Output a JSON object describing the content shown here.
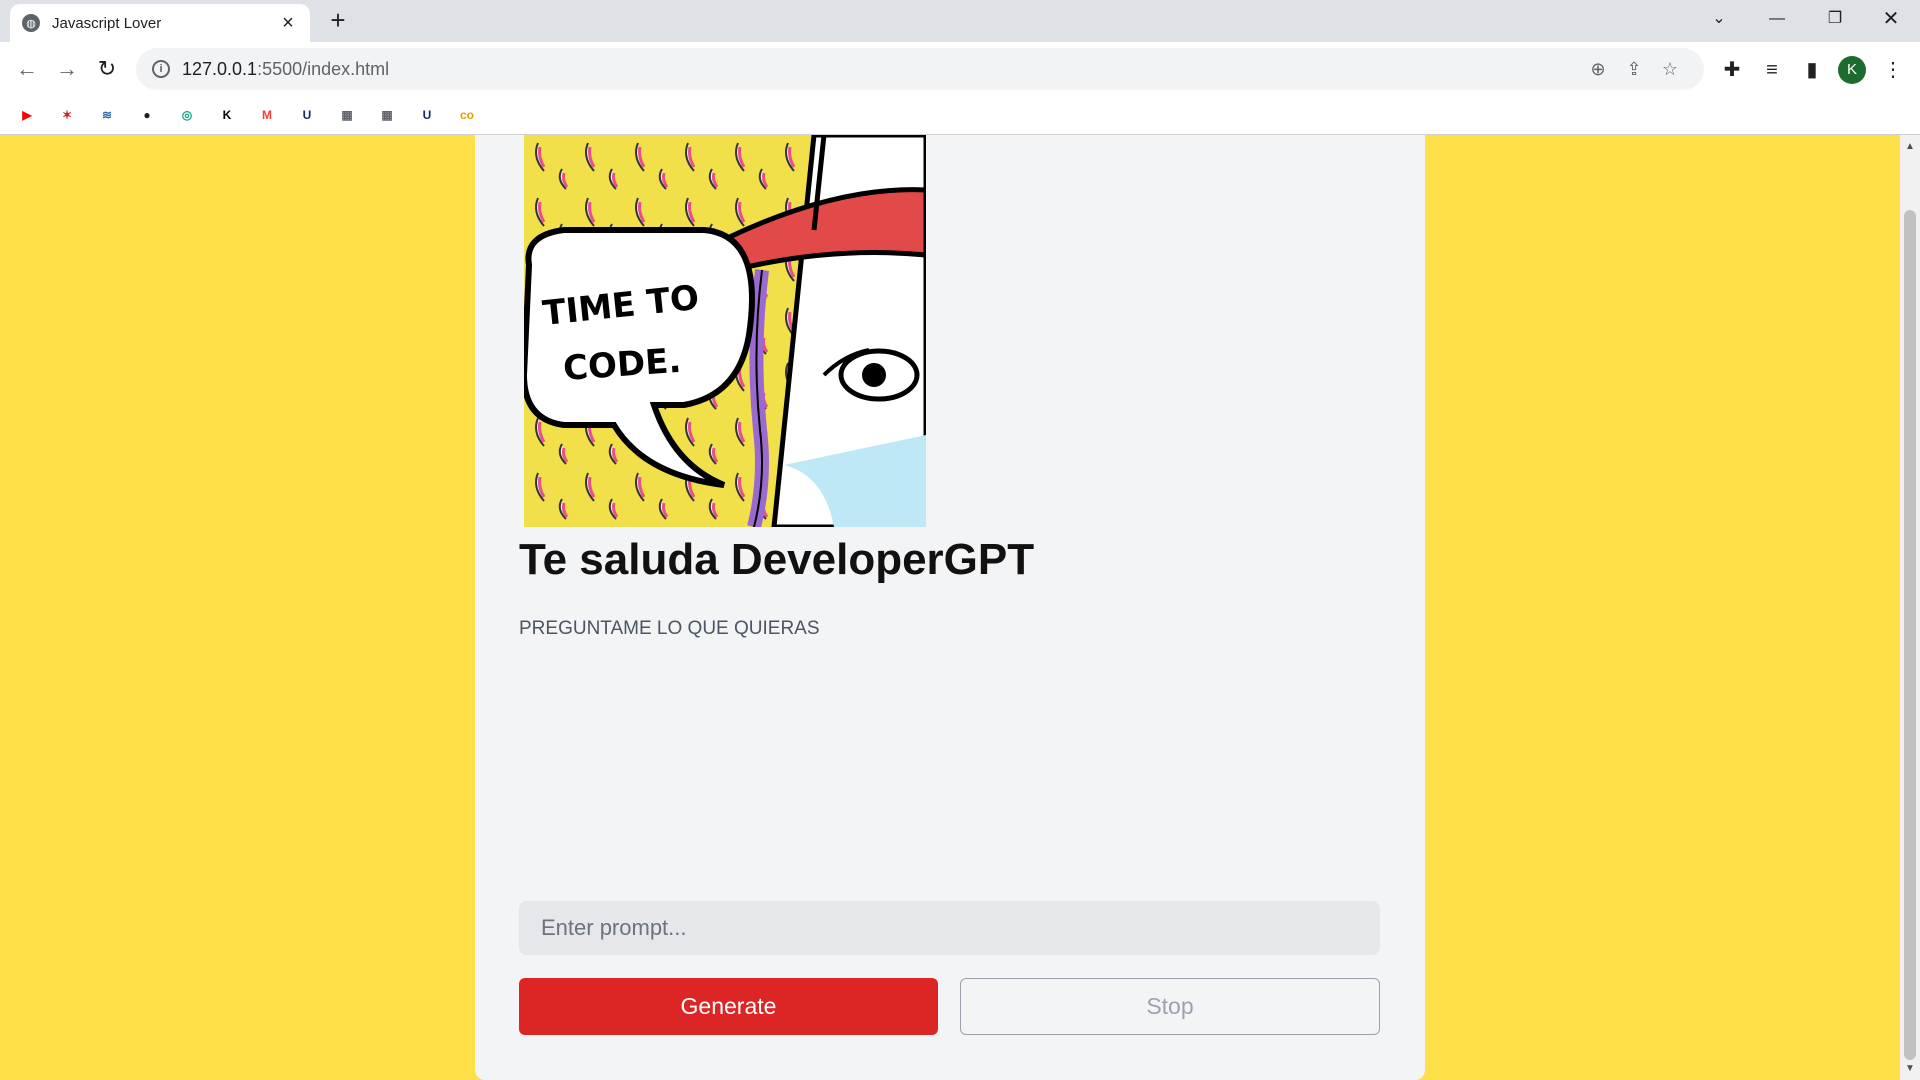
{
  "browser": {
    "tab_title": "Javascript Lover",
    "url_host": "127.0.0.1",
    "url_rest": ":5500/index.html",
    "avatar_letter": "K"
  },
  "bookmarks": [
    {
      "icon": "youtube-icon",
      "glyph": "▶",
      "color": "#ff0000"
    },
    {
      "icon": "figure-icon",
      "glyph": "✶",
      "color": "#d21f1f"
    },
    {
      "icon": "stack-icon",
      "glyph": "≋",
      "color": "#2b6cb0"
    },
    {
      "icon": "dark-circle-icon",
      "glyph": "●",
      "color": "#202124"
    },
    {
      "icon": "chatgpt-icon",
      "glyph": "◎",
      "color": "#10a37f"
    },
    {
      "icon": "k-icon",
      "glyph": "K",
      "color": "#000000"
    },
    {
      "icon": "gmail-icon",
      "glyph": "M",
      "color": "#ea4335"
    },
    {
      "icon": "u-icon",
      "glyph": "U",
      "color": "#1a237e"
    },
    {
      "icon": "image-icon",
      "glyph": "▦",
      "color": "#5f6368"
    },
    {
      "icon": "image-icon",
      "glyph": "▦",
      "color": "#5f6368"
    },
    {
      "icon": "u-icon",
      "glyph": "U",
      "color": "#1a237e"
    },
    {
      "icon": "co-icon",
      "glyph": "co",
      "color": "#f29900"
    }
  ],
  "page": {
    "hero_text": "TIME TO CODE.",
    "heading": "Te saluda DeveloperGPT",
    "subtitle": "PREGUNTAME LO QUE QUIERAS",
    "prompt_placeholder": "Enter prompt...",
    "prompt_value": "",
    "generate_label": "Generate",
    "stop_label": "Stop"
  },
  "colors": {
    "background": "#fde047",
    "card": "#f3f4f6",
    "generate": "#dc2626"
  }
}
